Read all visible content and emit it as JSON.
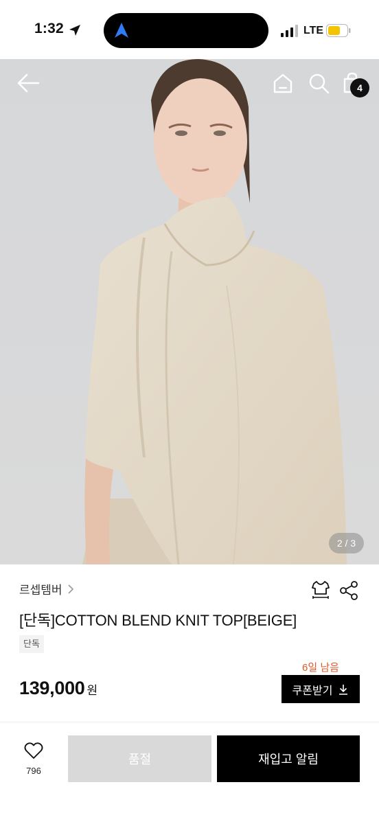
{
  "status_bar": {
    "time": "1:32",
    "network": "LTE"
  },
  "header": {
    "cart_count": "4",
    "icons": [
      "back-arrow-icon",
      "home-icon",
      "search-icon",
      "shopping-bag-icon"
    ]
  },
  "gallery": {
    "indicator": "2 / 3"
  },
  "product": {
    "brand": "르셉템버",
    "title": "[단독]COTTON BLEND KNIT TOP[BEIGE]",
    "tag": "단독",
    "remaining_label": "6일 남음",
    "price": "139,000",
    "price_unit": "원",
    "coupon_label": "쿠폰받기"
  },
  "bottom_bar": {
    "like_count": "796",
    "soldout_label": "품절",
    "restock_label": "재입고 알림"
  },
  "colors": {
    "accent": "#e0582a",
    "primary_button": "#000000",
    "disabled_button": "#d9d9d9"
  }
}
